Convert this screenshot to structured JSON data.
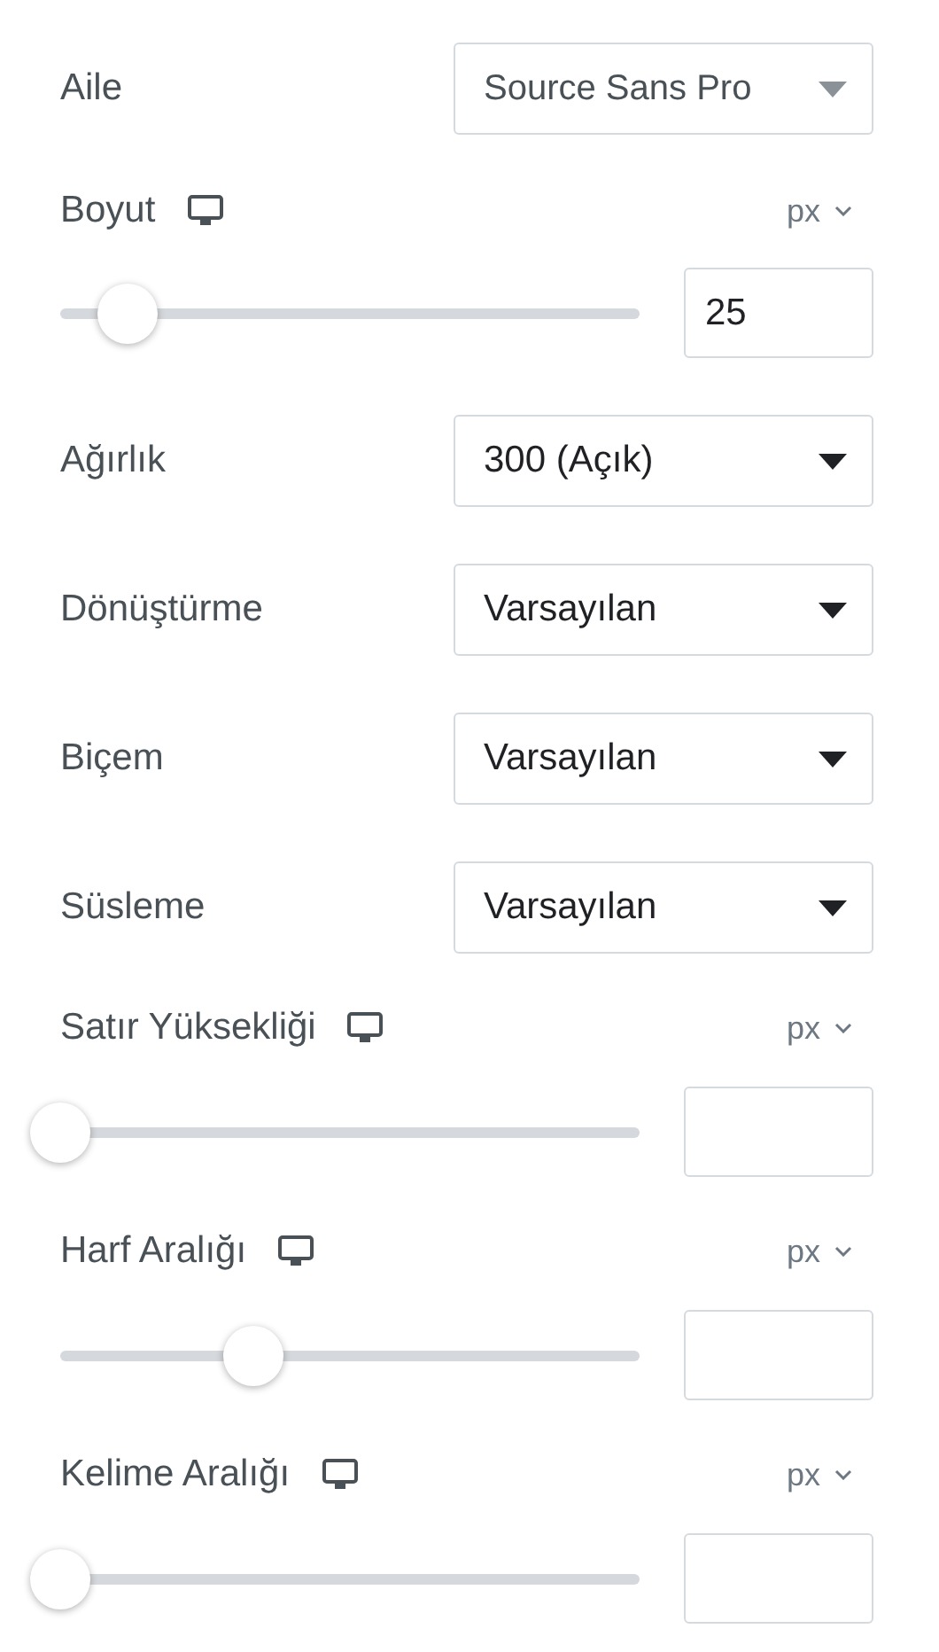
{
  "controls": [
    {
      "kind": "font-select",
      "label": "Aile",
      "value": "Source Sans Pro"
    },
    {
      "kind": "slider",
      "label": "Boyut",
      "unit": "px",
      "value": "25",
      "level": 0.116
    },
    {
      "kind": "select",
      "label": "Ağırlık",
      "value": "300 (Açık)"
    },
    {
      "kind": "select",
      "label": "Dönüştürme",
      "value": "Varsayılan"
    },
    {
      "kind": "select",
      "label": "Biçem",
      "value": "Varsayılan"
    },
    {
      "kind": "select",
      "label": "Süsleme",
      "value": "Varsayılan"
    },
    {
      "kind": "slider",
      "label": "Satır Yüksekliği",
      "unit": "px",
      "level": 0
    },
    {
      "kind": "slider",
      "label": "Harf Aralığı",
      "unit": "px",
      "level": 0.333
    },
    {
      "kind": "slider",
      "label": "Kelime Aralığı",
      "unit": "px",
      "level": 0
    }
  ]
}
